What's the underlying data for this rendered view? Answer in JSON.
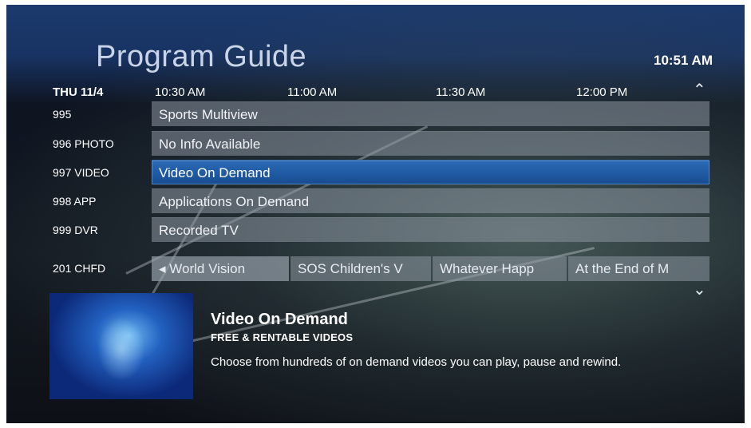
{
  "header": {
    "title": "Program Guide",
    "clock": "10:51 AM"
  },
  "timebar": {
    "day": "THU 11/4",
    "times": [
      "10:30 AM",
      "11:00 AM",
      "11:30 AM",
      "12:00 PM"
    ]
  },
  "channels": [
    {
      "number": "995",
      "program": "Sports Multiview"
    },
    {
      "number": "996 PHOTO",
      "program": "No Info Available"
    },
    {
      "number": "997 VIDEO",
      "program": "Video On Demand",
      "selected": true
    },
    {
      "number": "998 APP",
      "program": "Applications On Demand"
    },
    {
      "number": "999 DVR",
      "program": "Recorded TV"
    }
  ],
  "last_row": {
    "number": "201 CHFD",
    "programs": [
      "◂ World Vision",
      "SOS Children's V",
      "Whatever Happ",
      "At the End of M"
    ]
  },
  "info": {
    "title": "Video On Demand",
    "subtitle": "FREE & RENTABLE VIDEOS",
    "description": "Choose from hundreds of on demand videos you can play, pause and rewind."
  },
  "icons": {
    "scroll_up": "chevron-up-icon",
    "scroll_down": "chevron-down-icon"
  },
  "colors": {
    "selected": "#1f5aa3",
    "header_band": "#1c3a6d",
    "cell": "#8c96a0"
  }
}
